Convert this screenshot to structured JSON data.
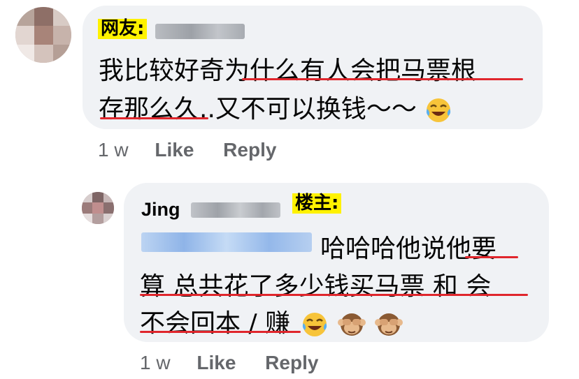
{
  "comment1": {
    "tag": "网友:",
    "line1": "我比较好奇为什么有人会把马票根",
    "line2": "存那么久..又不可以换钱～～",
    "line2_emoji": "face-with-tears-of-joy-icon",
    "time": "1 w",
    "like": "Like",
    "reply": "Reply"
  },
  "comment2": {
    "name": "Jing",
    "tag": "楼主:",
    "line1": "哈哈哈他说他要",
    "line2": "算 总共花了多少钱买马票 和 会",
    "line3": "不会回本 / 赚",
    "line3_emojis": [
      "face-with-tears-of-joy-icon",
      "see-no-evil-monkey-icon",
      "see-no-evil-monkey-icon"
    ],
    "time": "1 w",
    "like": "Like",
    "reply": "Reply"
  },
  "colors": {
    "bubble": "#f0f2f5",
    "meta_text": "#65676b",
    "highlight": "#fff200",
    "underline": "#e0262c"
  }
}
